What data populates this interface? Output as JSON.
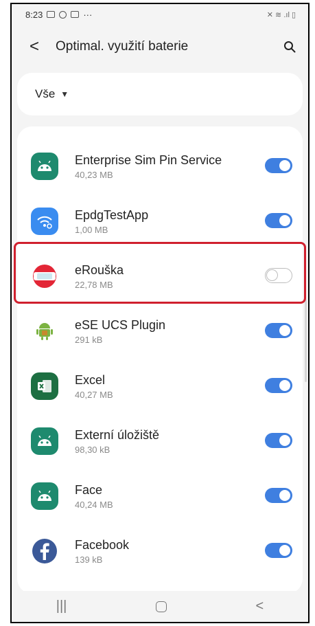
{
  "status_bar": {
    "time": "8:23",
    "extra": "···",
    "right_icons": "✕ ≋ .ıl ▯"
  },
  "header": {
    "back_label": "<",
    "title": "Optimal. využití baterie"
  },
  "filter": {
    "label": "Vše",
    "arrow": "▼"
  },
  "apps": [
    {
      "name": "Enterprise Sim Pin Service",
      "size": "40,23 MB",
      "enabled": true,
      "icon": "android-icon",
      "color": "#1e8a6e"
    },
    {
      "name": "EpdgTestApp",
      "size": "1,00 MB",
      "enabled": true,
      "icon": "wifi-settings-icon",
      "color": "#3a8cf0"
    },
    {
      "name": "eRouška",
      "size": "22,78 MB",
      "enabled": false,
      "icon": "erouska-icon",
      "color": "#e32636"
    },
    {
      "name": "eSE UCS Plugin",
      "size": "291 kB",
      "enabled": true,
      "icon": "android-robot-icon",
      "color": "#7cb342"
    },
    {
      "name": "Excel",
      "size": "40,27 MB",
      "enabled": true,
      "icon": "excel-icon",
      "color": "#1d6f42"
    },
    {
      "name": "Externí úložiště",
      "size": "98,30 kB",
      "enabled": true,
      "icon": "android-icon",
      "color": "#1e8a6e"
    },
    {
      "name": "Face",
      "size": "40,24 MB",
      "enabled": true,
      "icon": "android-icon",
      "color": "#1e8a6e"
    },
    {
      "name": "Facebook",
      "size": "139 kB",
      "enabled": true,
      "icon": "facebook-icon",
      "color": "#3b5998"
    }
  ],
  "navbar": {
    "recents": "|||",
    "back": "<"
  },
  "colors": {
    "accent": "#3f7fe0",
    "highlight": "#d0202e"
  }
}
